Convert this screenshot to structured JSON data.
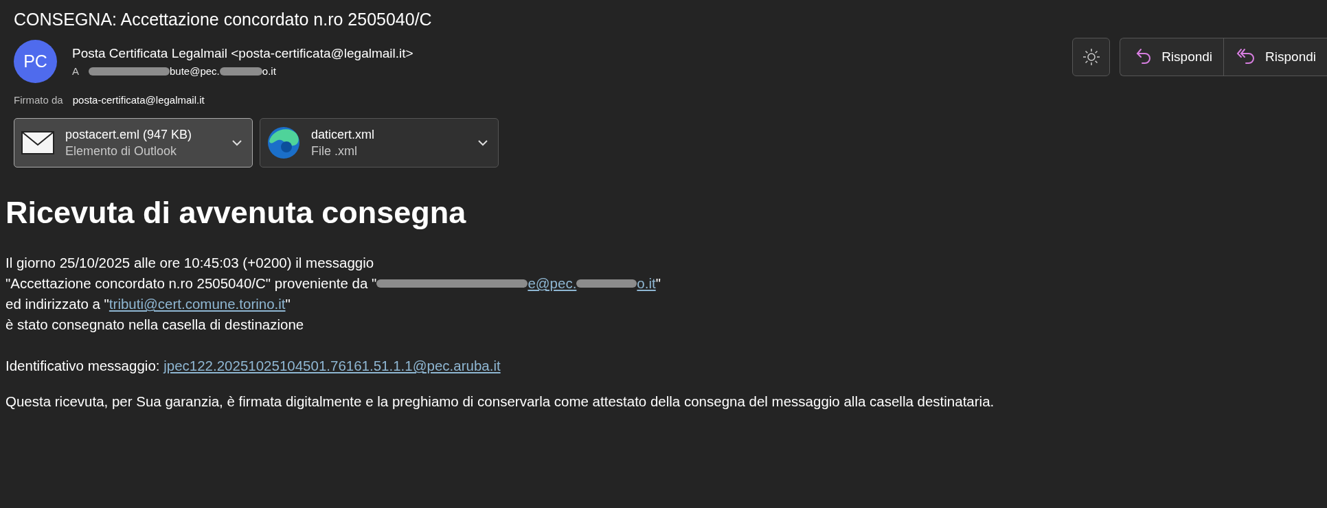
{
  "subject": "CONSEGNA: Accettazione concordato n.ro  2505040/C",
  "sender": {
    "initials": "PC",
    "name": "Posta Certificata Legalmail <posta-certificata@legalmail.it>",
    "to_label": "A",
    "to_visible": [
      "bute@pec.",
      "o.it"
    ]
  },
  "signed": {
    "label": "Firmato da",
    "value": "posta-certificata@legalmail.it"
  },
  "toolbar": [
    {
      "kind": "theme"
    },
    {
      "kind": "reply",
      "label": "Rispondi"
    },
    {
      "kind": "reply_all",
      "label": "Rispondi"
    }
  ],
  "attachments": [
    {
      "kind": "mail",
      "name": "postacert.eml (947 KB)",
      "type": "Elemento di Outlook",
      "selected": true
    },
    {
      "kind": "browser",
      "name": "daticert.xml",
      "type": "File .xml",
      "selected": false
    }
  ],
  "body": {
    "heading": "Ricevuta di avvenuta consegna",
    "line_1": "Il giorno 25/10/2025 alle ore 10:45:03 (+0200) il messaggio",
    "line_2_prefix": "\"Accettazione concordato n.ro 2505040/C\" proveniente da \"",
    "line_2_link_visible": [
      "e@pec.",
      "o.it"
    ],
    "line_2_suffix": "\"",
    "line_3_prefix": "ed indirizzato a \"",
    "line_3_link": "tributi@cert.comune.torino.it",
    "line_3_suffix": "\"",
    "line_4": "è stato consegnato nella casella di destinazione",
    "id_label": "Identificativo messaggio: ",
    "id_link": "jpec122.20251025104501.76161.51.1.1@pec.aruba.it",
    "closing": "Questa ricevuta, per Sua garanzia, è firmata digitalmente e la preghiamo di conservarla come attestato della consegna del messaggio alla casella destinataria."
  }
}
